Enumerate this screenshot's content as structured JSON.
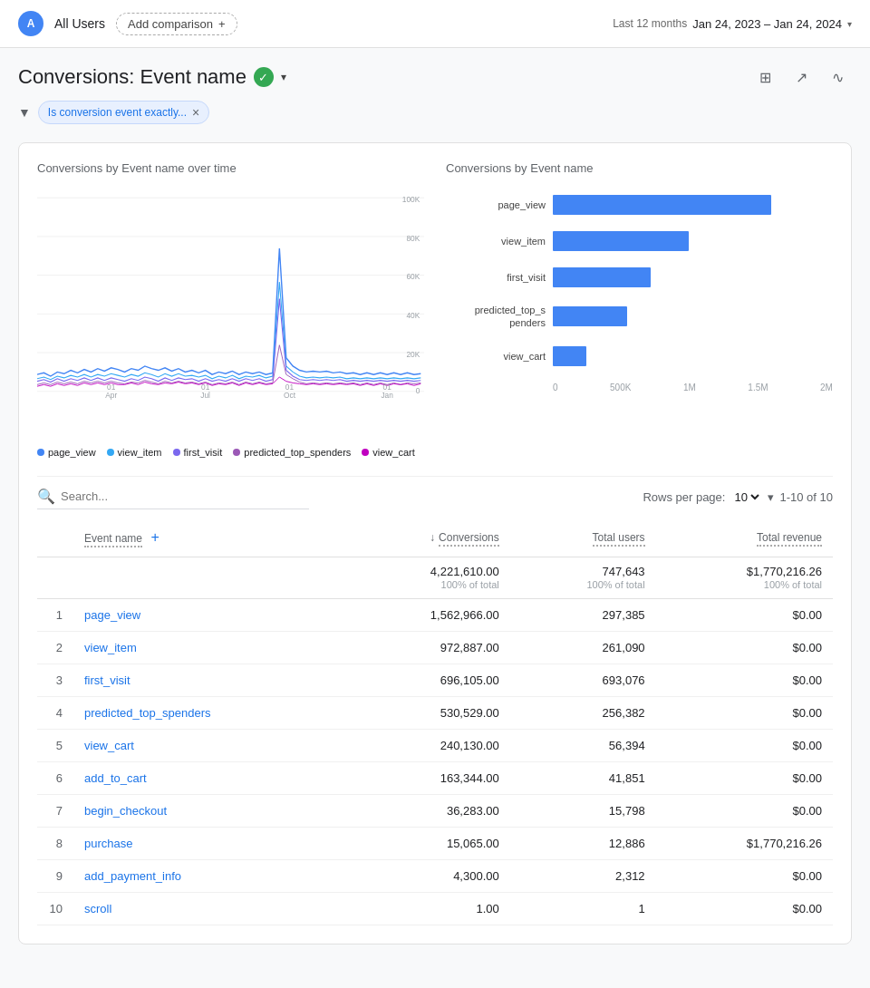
{
  "header": {
    "avatar_letter": "A",
    "all_users_label": "All Users",
    "add_comparison_label": "Add comparison",
    "add_comparison_plus": "+",
    "date_range_label": "Last 12 months",
    "date_range_dates": "Jan 24, 2023 – Jan 24, 2024",
    "icons": {
      "calendar": "📅",
      "table": "⊞",
      "share": "↗",
      "insights": "〜"
    }
  },
  "page": {
    "title_prefix": "Conversions: ",
    "title_dimension": "Event name",
    "filter_text": "Is conversion event exactly...",
    "filter_remove": "×"
  },
  "chart_left": {
    "title": "Conversions by Event name over time",
    "y_labels": [
      "100K",
      "80K",
      "60K",
      "40K",
      "20K",
      "0"
    ],
    "x_labels": [
      "01\nApr",
      "01\nJul",
      "01\nOct",
      "01\nJan"
    ],
    "legend": [
      {
        "label": "page_view",
        "color": "#4285f4"
      },
      {
        "label": "view_item",
        "color": "#34a8f4"
      },
      {
        "label": "first_visit",
        "color": "#7b68ee"
      },
      {
        "label": "predicted_top_spenders",
        "color": "#9b59b6"
      },
      {
        "label": "view_cart",
        "color": "#c000c0"
      }
    ]
  },
  "chart_right": {
    "title": "Conversions by Event name",
    "bars": [
      {
        "label": "page_view",
        "value": 1562966,
        "max": 2000000
      },
      {
        "label": "view_item",
        "value": 972887,
        "max": 2000000
      },
      {
        "label": "first_visit",
        "value": 696105,
        "max": 2000000
      },
      {
        "label": "predicted_top_\nspenders",
        "value": 530529,
        "max": 2000000
      },
      {
        "label": "view_cart",
        "value": 240130,
        "max": 2000000
      }
    ],
    "x_axis_labels": [
      "0",
      "500K",
      "1M",
      "1.5M",
      "2M"
    ],
    "bar_color": "#4285f4"
  },
  "table": {
    "search_placeholder": "Search...",
    "rows_per_page_label": "Rows per page:",
    "rows_per_page_value": "10",
    "pagination": "1-10 of 10",
    "columns": [
      {
        "key": "event_name",
        "label": "Event name",
        "numeric": false,
        "sortable": false
      },
      {
        "key": "conversions",
        "label": "Conversions",
        "numeric": true,
        "sortable": true
      },
      {
        "key": "total_users",
        "label": "Total users",
        "numeric": true,
        "sortable": false
      },
      {
        "key": "total_revenue",
        "label": "Total revenue",
        "numeric": true,
        "sortable": false
      }
    ],
    "totals": {
      "conversions": "4,221,610.00",
      "conversions_pct": "100% of total",
      "total_users": "747,643",
      "total_users_pct": "100% of total",
      "total_revenue": "$1,770,216.26",
      "total_revenue_pct": "100% of total"
    },
    "rows": [
      {
        "num": 1,
        "event_name": "page_view",
        "conversions": "1,562,966.00",
        "total_users": "297,385",
        "total_revenue": "$0.00"
      },
      {
        "num": 2,
        "event_name": "view_item",
        "conversions": "972,887.00",
        "total_users": "261,090",
        "total_revenue": "$0.00"
      },
      {
        "num": 3,
        "event_name": "first_visit",
        "conversions": "696,105.00",
        "total_users": "693,076",
        "total_revenue": "$0.00"
      },
      {
        "num": 4,
        "event_name": "predicted_top_spenders",
        "conversions": "530,529.00",
        "total_users": "256,382",
        "total_revenue": "$0.00"
      },
      {
        "num": 5,
        "event_name": "view_cart",
        "conversions": "240,130.00",
        "total_users": "56,394",
        "total_revenue": "$0.00"
      },
      {
        "num": 6,
        "event_name": "add_to_cart",
        "conversions": "163,344.00",
        "total_users": "41,851",
        "total_revenue": "$0.00"
      },
      {
        "num": 7,
        "event_name": "begin_checkout",
        "conversions": "36,283.00",
        "total_users": "15,798",
        "total_revenue": "$0.00"
      },
      {
        "num": 8,
        "event_name": "purchase",
        "conversions": "15,065.00",
        "total_users": "12,886",
        "total_revenue": "$1,770,216.26"
      },
      {
        "num": 9,
        "event_name": "add_payment_info",
        "conversions": "4,300.00",
        "total_users": "2,312",
        "total_revenue": "$0.00"
      },
      {
        "num": 10,
        "event_name": "scroll",
        "conversions": "1.00",
        "total_users": "1",
        "total_revenue": "$0.00"
      }
    ]
  }
}
